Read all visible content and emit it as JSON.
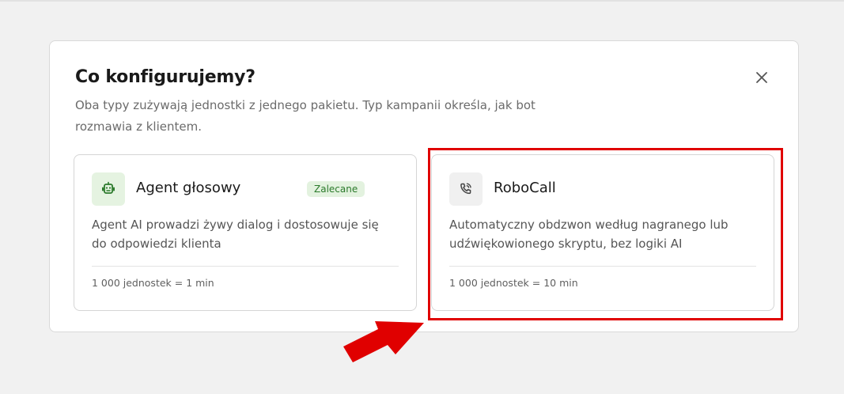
{
  "dialog": {
    "title": "Co konfigurujemy?",
    "description": "Oba typy zużywają jednostki z jednego pakietu. Typ kampanii określa, jak bot rozmawia z klientem.",
    "close_icon": "close-icon"
  },
  "cards": {
    "agent": {
      "icon": "robot-icon",
      "title": "Agent głosowy",
      "badge": "Zalecane",
      "description": "Agent AI prowadzi żywy dialog i dostosowuje się do odpowiedzi klienta",
      "meta": "1 000 jednostek = 1 min"
    },
    "robocall": {
      "icon": "phone-call-icon",
      "title": "RoboCall",
      "description": "Automatyczny obdzwon według nagranego lub udźwiękowionego skryptu, bez logiki AI",
      "meta": "1 000 jednostek = 10 min"
    }
  },
  "annotation": {
    "highlight_color": "#e00000",
    "arrow_color": "#e00000"
  },
  "colors": {
    "accent_green": "#2b7a2b",
    "badge_bg": "#e3f2df",
    "background": "#f1f1f1"
  }
}
